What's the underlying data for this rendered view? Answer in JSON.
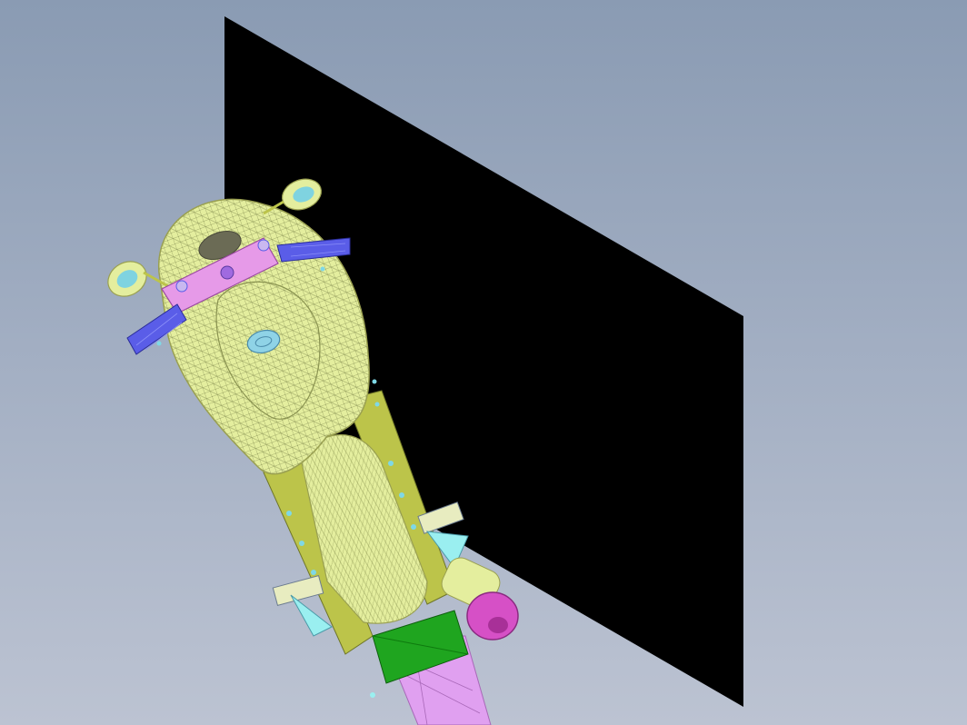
{
  "viewport": {
    "background_top": "#8a9bb3",
    "background_bottom": "#bcc3d2"
  },
  "scene": {
    "objects": [
      {
        "name": "ground-plane",
        "color": "#000000"
      },
      {
        "name": "motorcycle-body-wireframe",
        "color": "#e4ee9e"
      },
      {
        "name": "handlebar-assembly",
        "color": "#5a5de8"
      },
      {
        "name": "triple-clamp",
        "color": "#e69ae8"
      },
      {
        "name": "fuel-cap",
        "color": "#8fd3e6"
      },
      {
        "name": "footpeg-brackets",
        "color": "#9aeff0"
      },
      {
        "name": "exhaust-muffler",
        "color": "#d650c6"
      },
      {
        "name": "battery-box",
        "color": "#1fa51f"
      },
      {
        "name": "rear-fender",
        "color": "#e0a0f0"
      }
    ]
  }
}
